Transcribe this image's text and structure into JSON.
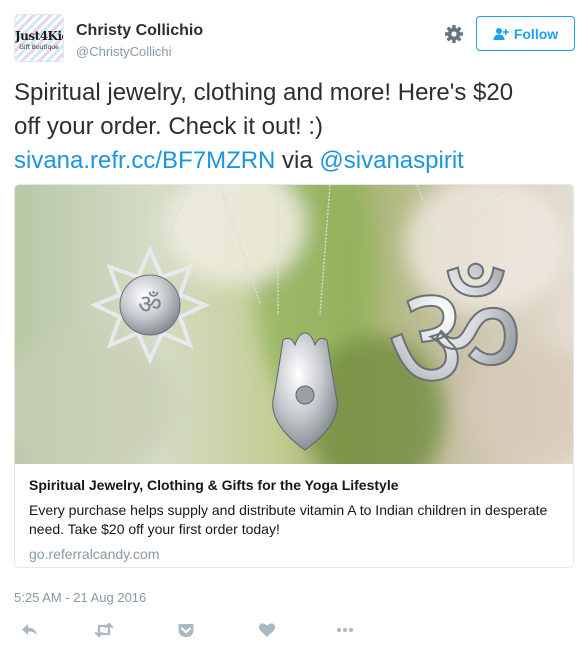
{
  "user": {
    "name": "Christy Collichio",
    "handle": "@ChristyCollichi",
    "avatar_text": "Just4Kids",
    "avatar_subtext": "Gift Boutique"
  },
  "follow": {
    "label": "Follow"
  },
  "tweet": {
    "line1": "Spiritual jewelry, clothing and more! Here's $20",
    "line2": "off your order. Check it out! :)",
    "link": "sivana.refr.cc/BF7MZRN",
    "via": " via ",
    "mention": "@sivanaspirit"
  },
  "card": {
    "title": "Spiritual Jewelry, Clothing & Gifts for the Yoga Lifestyle",
    "description": "Every purchase helps supply and distribute vitamin A to Indian children in desperate need. Take $20 off your first order today!",
    "domain": "go.referralcandy.com"
  },
  "timestamp": "5:25 AM - 21 Aug 2016",
  "colors": {
    "accent": "#1da1f2",
    "link": "#1b95e0",
    "muted": "#8899a6",
    "icon": "#aab8c2"
  },
  "icons": [
    "gear-icon",
    "follow-person-icon",
    "reply-icon",
    "retweet-icon",
    "pocket-icon",
    "like-icon",
    "more-icon"
  ]
}
